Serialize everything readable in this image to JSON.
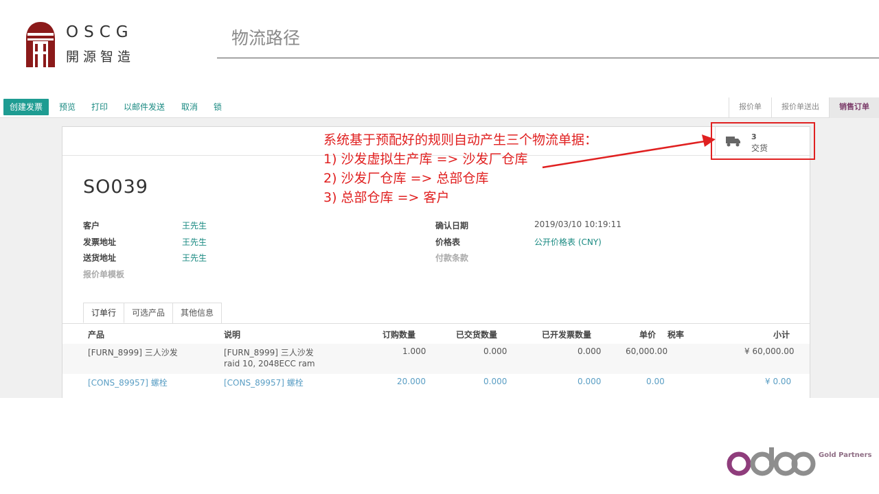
{
  "slide": {
    "title": "物流路径",
    "logo_en": "OSCG",
    "logo_cn": "開源智造",
    "partner_label": "Gold Partners",
    "odoo_logo": "odoo"
  },
  "toolbar": {
    "create_invoice": "创建发票",
    "preview": "预览",
    "print": "打印",
    "send_email": "以邮件发送",
    "cancel": "取消",
    "lock": "锁"
  },
  "stages": [
    "报价单",
    "报价单送出",
    "销售订单"
  ],
  "smart_button": {
    "count": "3",
    "label": "交货",
    "icon": "truck-icon"
  },
  "order": {
    "name": "SO039",
    "left_fields": [
      {
        "label": "客户",
        "value": "王先生"
      },
      {
        "label": "发票地址",
        "value": "王先生"
      },
      {
        "label": "送货地址",
        "value": "王先生"
      },
      {
        "label": "报价单模板",
        "value": ""
      }
    ],
    "right_fields": [
      {
        "label": "确认日期",
        "value": "2019/03/10 10:19:11"
      },
      {
        "label": "价格表",
        "value": "公开价格表 (CNY)"
      },
      {
        "label": "付款条款",
        "value": ""
      }
    ]
  },
  "tabs": [
    "订单行",
    "可选产品",
    "其他信息"
  ],
  "table": {
    "headers": [
      "产品",
      "说明",
      "订购数量",
      "已交货数量",
      "已开发票数量",
      "单价",
      "税率",
      "小计"
    ],
    "rows": [
      {
        "product": "[FURN_8999] 三人沙发",
        "desc1": "[FURN_8999] 三人沙发",
        "desc2": "raid 10, 2048ECC ram",
        "qty": "1.000",
        "delivered": "0.000",
        "invoiced": "0.000",
        "price": "60,000.00",
        "tax": "",
        "subtotal": "¥ 60,000.00"
      },
      {
        "product": "[CONS_89957] 螺栓",
        "desc1": "[CONS_89957] 螺栓",
        "desc2": "",
        "qty": "20.000",
        "delivered": "0.000",
        "invoiced": "0.000",
        "price": "0.00",
        "tax": "",
        "subtotal": "¥ 0.00"
      }
    ]
  },
  "annotation": {
    "heading": "系统基于预配好的规则自动产生三个物流单据：",
    "lines": [
      "1) 沙发虚拟生产库 => 沙发厂仓库",
      "2) 沙发厂仓库 => 总部仓库",
      "3) 总部仓库 => 客户"
    ],
    "color": "#e02020"
  },
  "colors": {
    "primary": "#1e9c92",
    "link": "#1a8a82",
    "stage_active": "#7a3a68"
  }
}
